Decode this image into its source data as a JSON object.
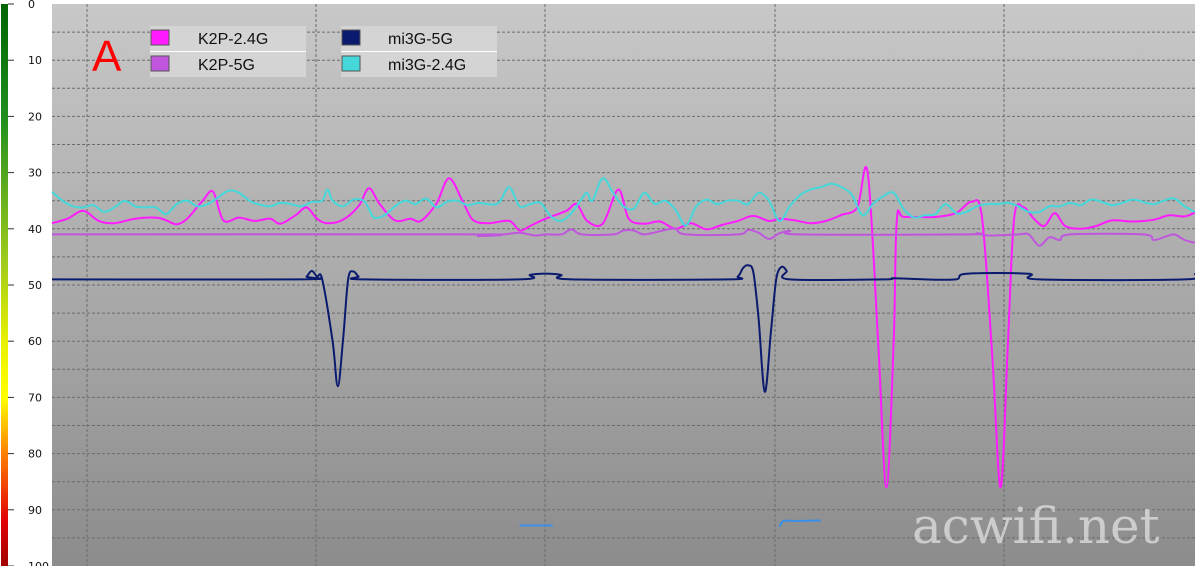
{
  "panel_label": "A",
  "watermark": "acwifi.net",
  "chart_data": {
    "type": "line",
    "title": "",
    "xlabel": "",
    "ylabel": "",
    "y_inverted": true,
    "ylim": [
      0,
      100
    ],
    "yticks": [
      0,
      10,
      20,
      30,
      40,
      50,
      60,
      70,
      80,
      90,
      100
    ],
    "xlim": [
      0,
      100
    ],
    "grid": true,
    "legend_position": "top-left",
    "legend_columns": [
      [
        "K2P-2.4G",
        "K2P-5G"
      ],
      [
        "mi3G-5G",
        "mi3G-2.4G"
      ]
    ],
    "series": [
      {
        "name": "K2P-2.4G",
        "color": "#ff1aff",
        "points": [
          [
            0,
            39
          ],
          [
            1.5,
            38.2
          ],
          [
            3,
            36.8
          ],
          [
            4.5,
            38.6
          ],
          [
            6,
            39
          ],
          [
            8,
            38.2
          ],
          [
            10,
            38
          ],
          [
            11,
            38.5
          ],
          [
            12,
            39.2
          ],
          [
            13,
            38.2
          ],
          [
            14.5,
            35
          ],
          [
            15.5,
            33.4
          ],
          [
            16.5,
            38.5
          ],
          [
            18,
            38
          ],
          [
            19.5,
            38.6
          ],
          [
            21,
            38.2
          ],
          [
            22,
            39.1
          ],
          [
            23.5,
            37.5
          ],
          [
            24.5,
            36.2
          ],
          [
            25.5,
            38.2
          ],
          [
            26.5,
            39
          ],
          [
            28,
            38.4
          ],
          [
            29.5,
            36
          ],
          [
            30.5,
            32.8
          ],
          [
            31.5,
            35.5
          ],
          [
            33,
            38.5
          ],
          [
            34.5,
            38.2
          ],
          [
            35.5,
            38.6
          ],
          [
            37,
            35.5
          ],
          [
            38.2,
            31
          ],
          [
            39.5,
            35
          ],
          [
            40.5,
            38.4
          ],
          [
            42,
            39
          ],
          [
            44,
            38.6
          ],
          [
            45,
            40.3
          ],
          [
            46,
            39.5
          ],
          [
            47.5,
            38.2
          ],
          [
            49.5,
            36.8
          ],
          [
            50.5,
            35.6
          ],
          [
            51.5,
            38.6
          ],
          [
            53,
            39.1
          ],
          [
            54.5,
            33
          ],
          [
            55.5,
            38.2
          ],
          [
            57,
            39.1
          ],
          [
            58.5,
            38.7
          ],
          [
            60,
            40
          ],
          [
            61.5,
            39
          ],
          [
            63,
            40.1
          ],
          [
            64.5,
            39.3
          ],
          [
            66,
            38.6
          ],
          [
            67.5,
            37.7
          ],
          [
            69,
            38.6
          ],
          [
            70,
            38.2
          ],
          [
            71.5,
            38.5
          ],
          [
            73,
            39
          ],
          [
            74.5,
            38.6
          ],
          [
            76,
            37.5
          ],
          [
            77.5,
            36.2
          ],
          [
            78.5,
            30
          ],
          [
            79.5,
            60
          ],
          [
            80.3,
            86
          ],
          [
            81,
            60
          ],
          [
            81.3,
            38.5
          ],
          [
            82,
            37.9
          ],
          [
            85,
            37.9
          ],
          [
            87,
            37.2
          ],
          [
            88.5,
            35.2
          ],
          [
            89.5,
            38
          ],
          [
            90.5,
            63
          ],
          [
            91.3,
            86
          ],
          [
            92,
            60
          ],
          [
            92.6,
            38
          ],
          [
            93.5,
            36.2
          ],
          [
            94.5,
            38.2
          ],
          [
            95.5,
            39.5
          ],
          [
            96.5,
            37.2
          ],
          [
            97.5,
            39.5
          ],
          [
            99,
            40
          ],
          [
            100.5,
            39.5
          ],
          [
            102,
            38.5
          ],
          [
            104,
            38.7
          ],
          [
            106,
            38.4
          ],
          [
            107.5,
            37.6
          ],
          [
            109,
            37.8
          ],
          [
            110,
            37.1
          ]
        ]
      },
      {
        "name": "K2P-5G",
        "color": "#bf56dd",
        "points": [
          [
            0,
            41
          ],
          [
            40,
            41
          ],
          [
            41,
            41.3
          ],
          [
            42,
            41
          ],
          [
            43.5,
            41
          ],
          [
            45,
            40.7
          ],
          [
            46.5,
            41.2
          ],
          [
            47.5,
            41
          ],
          [
            49,
            41
          ],
          [
            50,
            40.1
          ],
          [
            51,
            41
          ],
          [
            54,
            41
          ],
          [
            55,
            40.3
          ],
          [
            56,
            40.3
          ],
          [
            57,
            41
          ],
          [
            59,
            40.2
          ],
          [
            60,
            40
          ],
          [
            61,
            41
          ],
          [
            66,
            41
          ],
          [
            67,
            40.2
          ],
          [
            68,
            40.7
          ],
          [
            69,
            41.8
          ],
          [
            70,
            40.8
          ],
          [
            71,
            40.4
          ],
          [
            72,
            41
          ],
          [
            88,
            41
          ],
          [
            89,
            40.8
          ],
          [
            90,
            41.2
          ],
          [
            93,
            41
          ],
          [
            94,
            41
          ],
          [
            95,
            43
          ],
          [
            96,
            41.5
          ],
          [
            97,
            42
          ],
          [
            98,
            41
          ],
          [
            105,
            41
          ],
          [
            106,
            42
          ],
          [
            107,
            41.5
          ],
          [
            108,
            41
          ],
          [
            109,
            42
          ],
          [
            110,
            42.5
          ]
        ]
      },
      {
        "name": "mi3G-5G",
        "color": "#0a1a6e",
        "points": [
          [
            0,
            49
          ],
          [
            24,
            49
          ],
          [
            24.5,
            48.5
          ],
          [
            25,
            47.5
          ],
          [
            25.5,
            48.5
          ],
          [
            26,
            49
          ],
          [
            27,
            60
          ],
          [
            27.5,
            68
          ],
          [
            28,
            60
          ],
          [
            28.5,
            49
          ],
          [
            29,
            47.6
          ],
          [
            29.5,
            48.5
          ],
          [
            30,
            49
          ],
          [
            45,
            49
          ],
          [
            46,
            48.2
          ],
          [
            47,
            48
          ],
          [
            48,
            48
          ],
          [
            49,
            48.2
          ],
          [
            50,
            49
          ],
          [
            65,
            49
          ],
          [
            66,
            48.5
          ],
          [
            66.5,
            47
          ],
          [
            67,
            46.5
          ],
          [
            67.5,
            47.8
          ],
          [
            68,
            56
          ],
          [
            68.6,
            69
          ],
          [
            69.2,
            58
          ],
          [
            69.7,
            49
          ],
          [
            70.2,
            46.8
          ],
          [
            70.7,
            47.5
          ],
          [
            71,
            49
          ],
          [
            80,
            49
          ],
          [
            81,
            48.8
          ],
          [
            84,
            49
          ],
          [
            87,
            49
          ],
          [
            88,
            48
          ],
          [
            94,
            48
          ],
          [
            95,
            49
          ],
          [
            109,
            49
          ],
          [
            110,
            48
          ]
        ]
      },
      {
        "name": "mi3G-2.4G",
        "color": "#44d8da",
        "points": [
          [
            0,
            33.4
          ],
          [
            1,
            35
          ],
          [
            2,
            36
          ],
          [
            3,
            36.2
          ],
          [
            4,
            35.8
          ],
          [
            5,
            37
          ],
          [
            6,
            36.2
          ],
          [
            7,
            35
          ],
          [
            8,
            36
          ],
          [
            9,
            36.2
          ],
          [
            10,
            36.2
          ],
          [
            11,
            37.4
          ],
          [
            12,
            35.6
          ],
          [
            13,
            35
          ],
          [
            14,
            36
          ],
          [
            15,
            35.6
          ],
          [
            16,
            34.4
          ],
          [
            17,
            33.2
          ],
          [
            18,
            33.6
          ],
          [
            19,
            35
          ],
          [
            20,
            35.7
          ],
          [
            21,
            36
          ],
          [
            22,
            35.4
          ],
          [
            23,
            35.6
          ],
          [
            24,
            36
          ],
          [
            25,
            35.2
          ],
          [
            26,
            35
          ],
          [
            26.5,
            33
          ],
          [
            27,
            35
          ],
          [
            28,
            36
          ],
          [
            29,
            34.8
          ],
          [
            30,
            35
          ],
          [
            30.5,
            36.5
          ],
          [
            31,
            38
          ],
          [
            32,
            37.6
          ],
          [
            33,
            36
          ],
          [
            34,
            35
          ],
          [
            35,
            35.6
          ],
          [
            36,
            34.6
          ],
          [
            37,
            36.2
          ],
          [
            38,
            35.2
          ],
          [
            39,
            35
          ],
          [
            40,
            35.8
          ],
          [
            41,
            35.4
          ],
          [
            42,
            35.6
          ],
          [
            43,
            35.4
          ],
          [
            44,
            32.6
          ],
          [
            45,
            36
          ],
          [
            46,
            35.6
          ],
          [
            47,
            35.4
          ],
          [
            48,
            37.8
          ],
          [
            49,
            38.6
          ],
          [
            50,
            37.2
          ],
          [
            51,
            34.6
          ],
          [
            51.5,
            33.6
          ],
          [
            52,
            35
          ],
          [
            53,
            31
          ],
          [
            54,
            33.6
          ],
          [
            55,
            36
          ],
          [
            56,
            36.4
          ],
          [
            57,
            33.6
          ],
          [
            58,
            35.6
          ],
          [
            59,
            35
          ],
          [
            60,
            36.6
          ],
          [
            61,
            39.4
          ],
          [
            62,
            36
          ],
          [
            63,
            34.8
          ],
          [
            64,
            35.6
          ],
          [
            65,
            35
          ],
          [
            66,
            35
          ],
          [
            67,
            35.6
          ],
          [
            68,
            33.6
          ],
          [
            69,
            35
          ],
          [
            70,
            38.6
          ],
          [
            71,
            36
          ],
          [
            72,
            34
          ],
          [
            73,
            33
          ],
          [
            74,
            32.6
          ],
          [
            75,
            32
          ],
          [
            76,
            32.6
          ],
          [
            77,
            34
          ],
          [
            78,
            37.6
          ],
          [
            79,
            35.6
          ],
          [
            80,
            34.2
          ],
          [
            81,
            33.6
          ],
          [
            82,
            36.6
          ],
          [
            83,
            38
          ],
          [
            84,
            37.6
          ],
          [
            85,
            37.4
          ],
          [
            86,
            35.6
          ],
          [
            87,
            37.2
          ],
          [
            88,
            37
          ],
          [
            89,
            36
          ],
          [
            90,
            35.6
          ],
          [
            91,
            35.6
          ],
          [
            92,
            35.4
          ],
          [
            93,
            36
          ],
          [
            94,
            37
          ],
          [
            95,
            37
          ],
          [
            96,
            36
          ],
          [
            97,
            36
          ],
          [
            98,
            35.4
          ],
          [
            99,
            35.8
          ],
          [
            100,
            34.8
          ],
          [
            101,
            35.2
          ],
          [
            102,
            35.8
          ],
          [
            103,
            35.4
          ],
          [
            104,
            34.8
          ],
          [
            105,
            35.2
          ],
          [
            106,
            35.6
          ],
          [
            107,
            35
          ],
          [
            108,
            34.6
          ],
          [
            109,
            36
          ],
          [
            110,
            37
          ]
        ]
      },
      {
        "name": "",
        "color": "#3a8fe8",
        "points": [
          [
            45,
            92.8
          ],
          [
            48.2,
            92.8
          ]
        ]
      },
      {
        "name": "",
        "color": "#3a8fe8",
        "points": [
          [
            70,
            93
          ],
          [
            70.4,
            92
          ],
          [
            71.5,
            92
          ],
          [
            74,
            91.9
          ]
        ]
      }
    ]
  }
}
